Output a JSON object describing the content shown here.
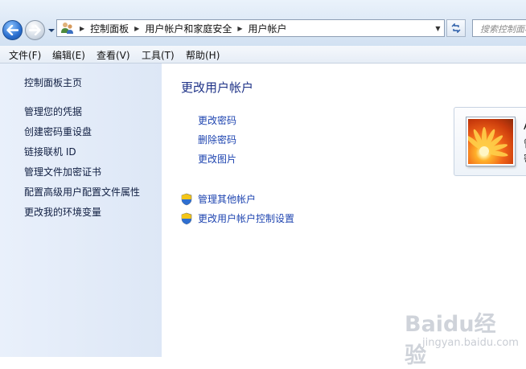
{
  "address_bar": {
    "crumbs": [
      "控制面板",
      "用户帐户和家庭安全",
      "用户帐户"
    ],
    "search_placeholder": "搜索控制面板"
  },
  "menu": {
    "items": [
      "文件(F)",
      "编辑(E)",
      "查看(V)",
      "工具(T)",
      "帮助(H)"
    ]
  },
  "sidebar": {
    "home": "控制面板主页",
    "links": [
      "管理您的凭据",
      "创建密码重设盘",
      "链接联机 ID",
      "管理文件加密证书",
      "配置高级用户配置文件属性",
      "更改我的环境变量"
    ]
  },
  "main": {
    "title": "更改用户帐户",
    "tasks": [
      "更改密码",
      "删除密码",
      "更改图片"
    ],
    "admin_tasks": [
      "管理其他帐户",
      "更改用户帐户控制设置"
    ]
  },
  "user_card": {
    "name_fragment": "A",
    "type_fragment_1": "管",
    "type_fragment_2": "密"
  },
  "watermark": {
    "brand": "Baidu经验",
    "url": "jingyan.baidu.com"
  }
}
